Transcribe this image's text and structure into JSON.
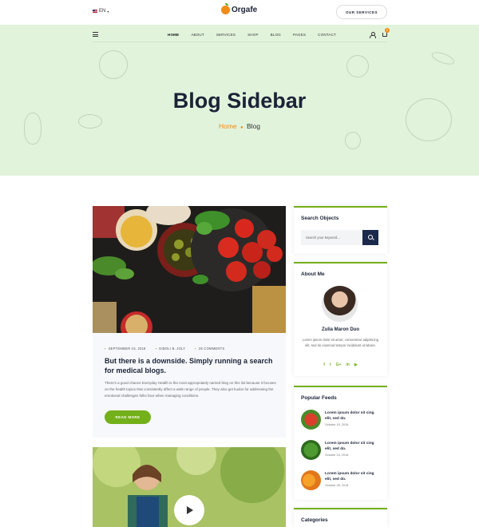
{
  "header": {
    "language": "EN",
    "logo_text": "Orgafe",
    "services_button": "OUR SERVICES"
  },
  "nav": {
    "items": [
      "HOME",
      "ABOUT",
      "SERVICES",
      "SHOP",
      "BLOG",
      "PAGES",
      "CONTACT"
    ],
    "cart_count": "0"
  },
  "hero": {
    "title": "Blog Sidebar",
    "breadcrumb_home": "Home",
    "breadcrumb_current": "Blog"
  },
  "post": {
    "date": "SEPTEMBER 15, 2018",
    "author": "DIBOLI B. JOLY",
    "comments": "25 COMMENTS",
    "title": "But there is a downside. Simply running a search for medical blogs.",
    "excerpt": "There's a good chance Everyday Health is the most appropriately named blog on this list because it focuses on the health topics that consistently affect a wide range of people. They also get kudos for addressing the emotional challenges folks face when managing conditions.",
    "read_more": "READ MORE"
  },
  "sidebar": {
    "search": {
      "title": "Search Objects",
      "placeholder": "Search your keyword..."
    },
    "about": {
      "title": "About Me",
      "name": "Zulia Maron Duo",
      "text": "Lorem ipsum dolor sit amet, consectetur adipisicing elit, sed do eiusmod tempor incididunt ut labore.",
      "socials": [
        "f",
        "t",
        "G+",
        "in",
        "▶"
      ]
    },
    "feeds": {
      "title": "Popular Feeds",
      "items": [
        {
          "title": "Lorem ipsum dolor sit cing elit, sed do.",
          "date": "October 15, 2018",
          "color": "#c9372c"
        },
        {
          "title": "Lorem ipsum dolor sit cing elit, sed do.",
          "date": "October 24, 2018",
          "color": "#3d8a2a"
        },
        {
          "title": "Lorem ipsum dolor sit cing elit, sed do.",
          "date": "October 28, 2018",
          "color": "#f28b1a"
        }
      ]
    },
    "categories": {
      "title": "Categories"
    }
  },
  "colors": {
    "accent": "#74b01a",
    "brand_orange": "#f28b1a",
    "hero_bg": "#e2f3dc",
    "dark": "#1b2337"
  }
}
